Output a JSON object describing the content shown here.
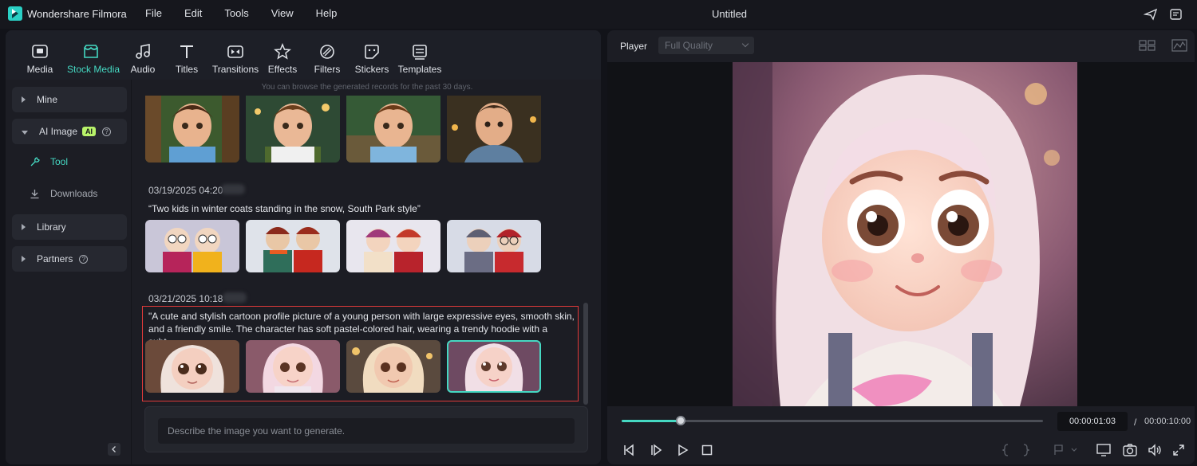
{
  "titlebar": {
    "app_name": "Wondershare Filmora",
    "menu": [
      "File",
      "Edit",
      "Tools",
      "View",
      "Help"
    ],
    "doc_title": "Untitled"
  },
  "toolbar": {
    "items": [
      {
        "label": "Media",
        "icon": "media-icon"
      },
      {
        "label": "Stock Media",
        "icon": "stock-media-icon",
        "active": true
      },
      {
        "label": "Audio",
        "icon": "audio-icon"
      },
      {
        "label": "Titles",
        "icon": "titles-icon"
      },
      {
        "label": "Transitions",
        "icon": "transitions-icon"
      },
      {
        "label": "Effects",
        "icon": "effects-icon"
      },
      {
        "label": "Filters",
        "icon": "filters-icon"
      },
      {
        "label": "Stickers",
        "icon": "stickers-icon"
      },
      {
        "label": "Templates",
        "icon": "templates-icon"
      }
    ]
  },
  "sidebar": {
    "mine": "Mine",
    "ai_image": "AI Image",
    "ai_badge": "AI",
    "tool": "Tool",
    "downloads": "Downloads",
    "library": "Library",
    "partners": "Partners"
  },
  "content": {
    "browse_note": "You can browse the generated records for the past 30 days.",
    "records": [
      {
        "date": "03/19/2025 04:20",
        "prompt": "“Two kids in winter coats standing in the snow, South Park style”"
      },
      {
        "date": "03/21/2025 10:18",
        "prompt": "\"A cute and stylish cartoon profile picture of a young person with large expressive eyes, smooth skin, and a friendly smile. The character has soft pastel-colored hair, wearing a trendy hoodie with a subt..."
      }
    ],
    "input_placeholder": "Describe the image you want to generate."
  },
  "player": {
    "label": "Player",
    "quality": "Full Quality",
    "current_time": "00:00:01:03",
    "separator": "/",
    "total_time": "00:00:10:00",
    "progress": 0.14
  },
  "colors": {
    "accent": "#45d8c2",
    "highlight_box": "#e03a3a",
    "ai_badge": "#b8f36a"
  }
}
